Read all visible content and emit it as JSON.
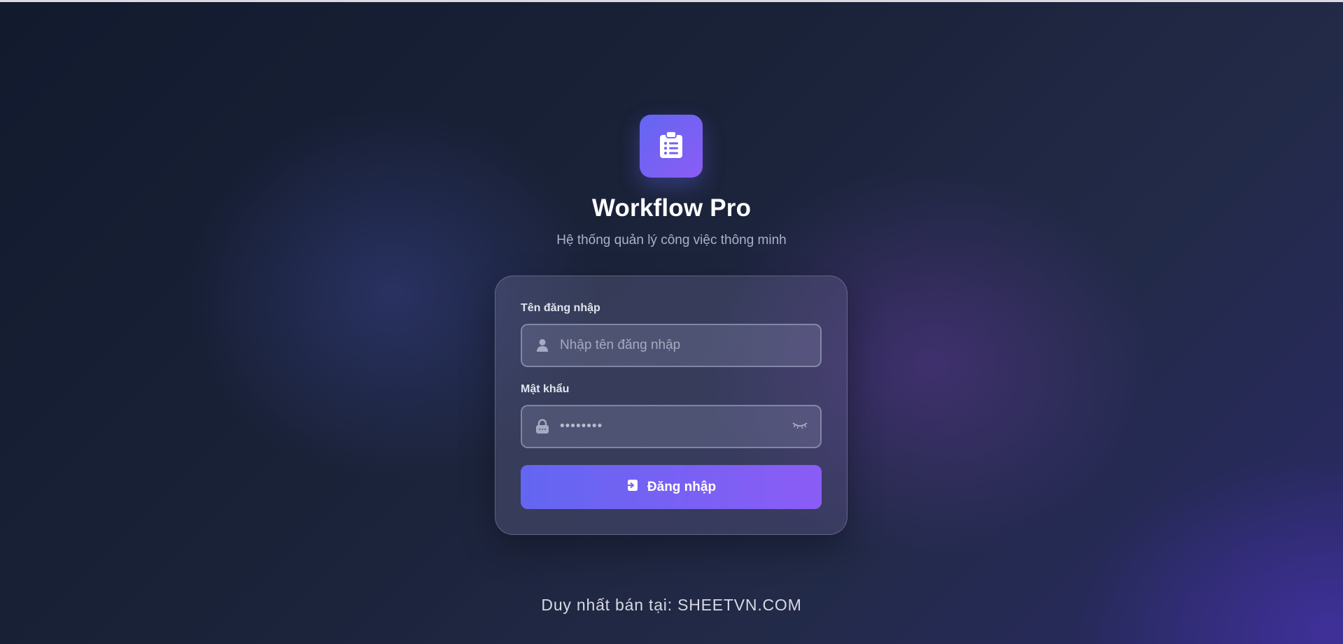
{
  "app": {
    "title": "Workflow Pro",
    "subtitle": "Hệ thống quản lý công việc thông minh",
    "logo_icon": "clipboard-list-icon",
    "accent_start": "#6366f1",
    "accent_end": "#8b5cf6"
  },
  "login": {
    "username_label": "Tên đăng nhập",
    "username_placeholder": "Nhập tên đăng nhập",
    "username_icon": "user-icon",
    "password_label": "Mật khẩu",
    "password_mask": "••••••••",
    "password_icon": "lock-icon",
    "toggle_icon": "eye-closed-icon",
    "submit_label": "Đăng nhập",
    "submit_icon": "login-icon"
  },
  "footer": {
    "text": "Duy nhất bán tại: SHEETVN.COM"
  }
}
